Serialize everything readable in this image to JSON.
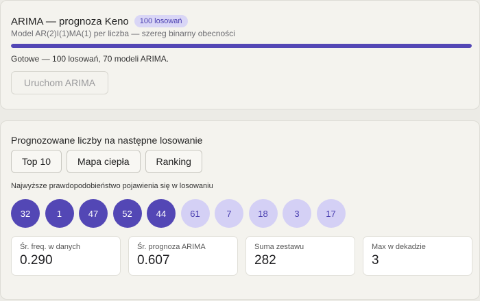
{
  "arima": {
    "title": "ARIMA — prognoza Keno",
    "badge": "100 losowań",
    "subtitle": "Model AR(2)I(1)MA(1) per liczba — szereg binarny obecności",
    "progress": 1.0,
    "status": "Gotowe — 100 losowań, 70 modeli ARIMA.",
    "run_button": "Uruchom ARIMA"
  },
  "prediction": {
    "title": "Prognozowane liczby na następne losowanie",
    "tabs": [
      {
        "label": "Top 10"
      },
      {
        "label": "Mapa ciepła"
      },
      {
        "label": "Ranking"
      }
    ],
    "hint": "Najwyższe prawdopodobieństwo pojawienia się w losowaniu",
    "numbers": [
      {
        "value": "32",
        "tier": "hot"
      },
      {
        "value": "1",
        "tier": "hot"
      },
      {
        "value": "47",
        "tier": "hot"
      },
      {
        "value": "52",
        "tier": "hot"
      },
      {
        "value": "44",
        "tier": "hot"
      },
      {
        "value": "61",
        "tier": "cold"
      },
      {
        "value": "7",
        "tier": "cold"
      },
      {
        "value": "18",
        "tier": "cold"
      },
      {
        "value": "3",
        "tier": "cold"
      },
      {
        "value": "17",
        "tier": "cold"
      }
    ],
    "stats": [
      {
        "label": "Śr. freq. w danych",
        "value": "0.290"
      },
      {
        "label": "Śr. prognoza ARIMA",
        "value": "0.607"
      },
      {
        "label": "Suma zestawu",
        "value": "282"
      },
      {
        "label": "Max w dekadzie",
        "value": "3"
      }
    ]
  },
  "colors": {
    "accent": "#5347b5",
    "accent_light": "#d4d0f5",
    "badge_bg": "#d9d6f6"
  }
}
